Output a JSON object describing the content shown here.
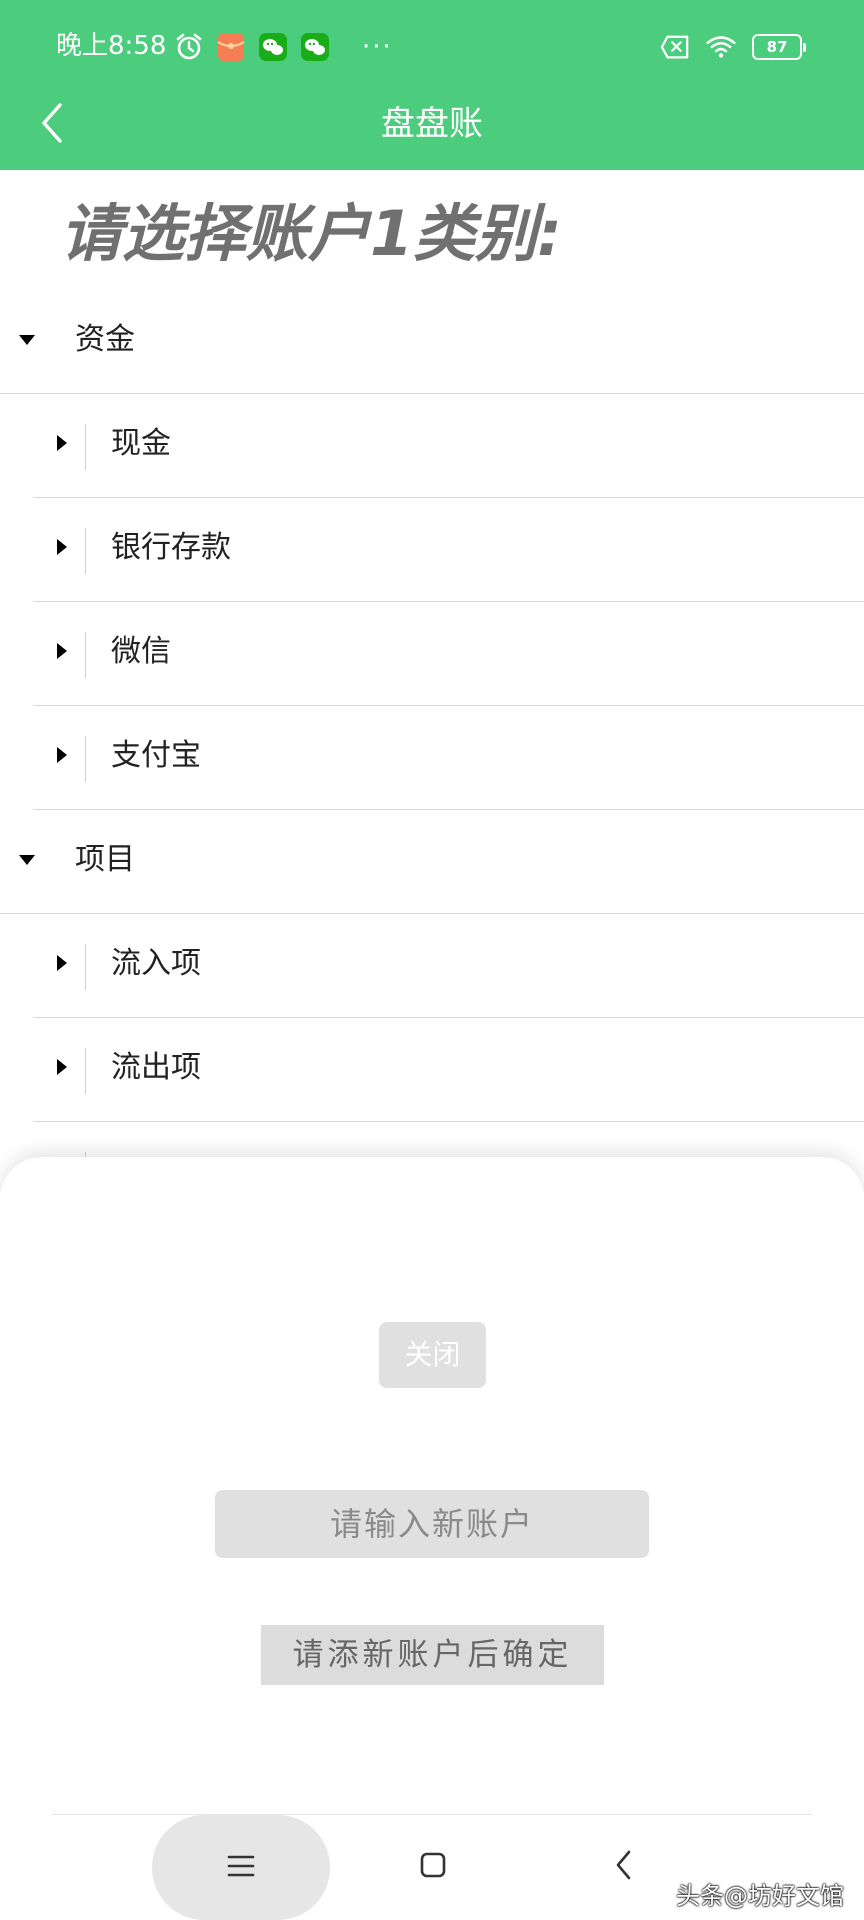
{
  "status_bar": {
    "time": "晚上8:58",
    "dots": "···",
    "battery": "87"
  },
  "nav": {
    "title": "盘盘账"
  },
  "page_title": "请选择账户1类别:",
  "tree": {
    "groups": [
      {
        "label": "资金",
        "children": [
          "现金",
          "银行存款",
          "微信",
          "支付宝"
        ]
      },
      {
        "label": "项目",
        "children": [
          "流入项",
          "流出项"
        ]
      }
    ]
  },
  "sheet": {
    "close_label": "关闭",
    "input_placeholder": "请输入新账户",
    "input_value": "",
    "confirm_label": "请添新账户后确定"
  },
  "watermark": "头条@坊好文馆",
  "colors": {
    "header_bg": "#4ccd7e",
    "title_gray": "#707070",
    "button_gray": "#e0e0e0"
  },
  "icons": {
    "back": "chevron-left-icon",
    "alarm": "alarm-clock-icon",
    "wechat": "wechat-icon",
    "wifi": "wifi-icon",
    "sim": "no-sim-icon",
    "battery": "battery-icon",
    "menu": "menu-icon",
    "home": "square-home-icon",
    "nav_back": "back-arrow-icon"
  }
}
